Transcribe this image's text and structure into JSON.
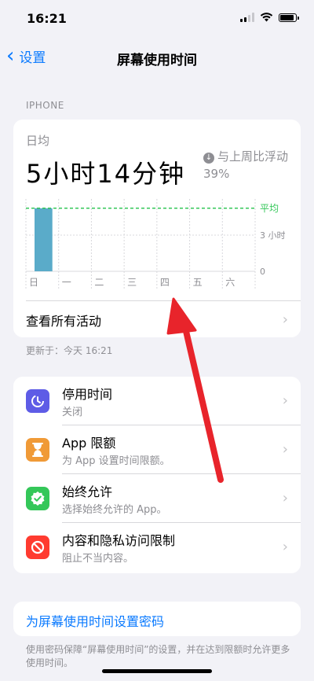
{
  "status_bar": {
    "time": "16:21"
  },
  "nav": {
    "back_label": "设置",
    "title": "屏幕使用时间"
  },
  "section": {
    "device_label": "IPHONE"
  },
  "usage": {
    "avg_label": "日均",
    "avg_value": "5小时14分钟",
    "compare_text": "与上周比浮动 39%",
    "see_all_label": "查看所有活动",
    "updated_text": "更新于：今天 16:21"
  },
  "chart_data": {
    "type": "bar",
    "categories": [
      "日",
      "一",
      "二",
      "三",
      "四",
      "五",
      "六"
    ],
    "values": [
      5.23,
      0,
      0,
      0,
      0,
      0,
      0
    ],
    "average": 5.23,
    "average_label": "平均",
    "ylim": [
      0,
      6
    ],
    "yticks": [
      {
        "value": 3,
        "label": "3 小时"
      },
      {
        "value": 0,
        "label": "0"
      }
    ],
    "bar_color": "#5aabc9",
    "average_color": "#34c759"
  },
  "settings": [
    {
      "title": "停用时间",
      "subtitle": "关闭",
      "icon": "downtime-icon",
      "color": "#5e5ce6"
    },
    {
      "title": "App 限额",
      "subtitle": "为 App 设置时间限额。",
      "icon": "hourglass-icon",
      "color": "#f09a37"
    },
    {
      "title": "始终允许",
      "subtitle": "选择始终允许的 App。",
      "icon": "checkmark-badge-icon",
      "color": "#34c759"
    },
    {
      "title": "内容和隐私访问限制",
      "subtitle": "阻止不当内容。",
      "icon": "restriction-icon",
      "color": "#ff3b30"
    }
  ],
  "passcode": {
    "button_label": "为屏幕使用时间设置密码",
    "footer_text": "使用密码保障“屏幕使用时间”的设置，并在达到限额时允许更多使用时间。"
  },
  "colors": {
    "accent": "#0a7aff",
    "annotation_arrow": "#e8242b"
  }
}
